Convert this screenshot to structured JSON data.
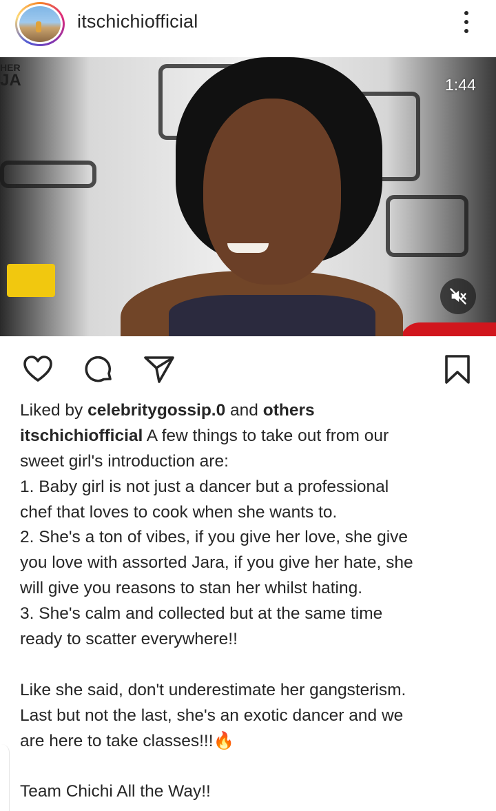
{
  "post": {
    "username": "itschichiofficial",
    "video_timestamp": "1:44",
    "overlay_logo_top": "HER",
    "overlay_logo_bottom": "JA"
  },
  "likes": {
    "prefix": "Liked by ",
    "user": "celebritygossip.0",
    "joiner": " and ",
    "others": "others"
  },
  "caption": {
    "author": "itschichiofficial",
    "lines": [
      " A few things to take out from our",
      "sweet girl's introduction are:",
      "1. Baby girl is not just a dancer but a professional",
      "chef that loves to cook when she wants to.",
      "2. She's a ton of vibes, if you give her love, she give",
      "you love with assorted Jara, if you give her hate, she",
      "will give you reasons to stan her whilst hating.",
      "3. She's calm and collected but at the same time",
      "ready to scatter everywhere!!",
      "",
      "Like she said, don't underestimate her gangsterism.",
      "Last but not the last, she's an exotic dancer and we",
      "are here to take classes!!!🔥",
      "",
      "Team Chichi All the Way!!"
    ]
  },
  "icons": {
    "more": "more-options-icon",
    "mute": "speaker-muted-icon",
    "like": "heart-icon",
    "comment": "comment-icon",
    "share": "send-icon",
    "save": "bookmark-icon"
  }
}
